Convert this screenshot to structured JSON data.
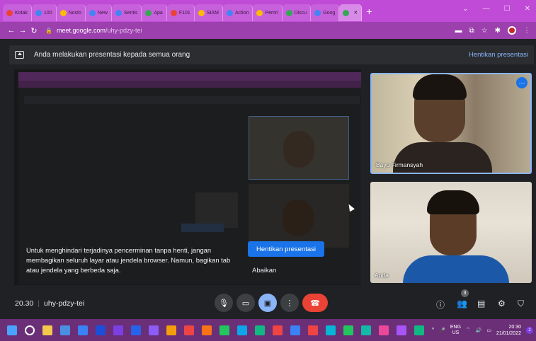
{
  "browser": {
    "tabs": [
      {
        "label": "Kotak",
        "color": "#ea4335"
      },
      {
        "label": "100",
        "color": "#4285f4"
      },
      {
        "label": "Nosto",
        "color": "#fbbc04"
      },
      {
        "label": "New",
        "color": "#4285f4"
      },
      {
        "label": "Sentis",
        "color": "#4285f4"
      },
      {
        "label": "Apa",
        "color": "#34a853"
      },
      {
        "label": "F101",
        "color": "#ea4335"
      },
      {
        "label": "SIAM",
        "color": "#fbbc04"
      },
      {
        "label": "Action",
        "color": "#4285f4"
      },
      {
        "label": "Pemri",
        "color": "#fbbc04"
      },
      {
        "label": "Discu",
        "color": "#34a853"
      },
      {
        "label": "Goog",
        "color": "#4285f4"
      },
      {
        "label": "",
        "color": "#34a853"
      }
    ],
    "url_domain": "meet.google.com",
    "url_path": "/uhy-pdzy-tei"
  },
  "meet": {
    "banner_text": "Anda melakukan presentasi kepada semua orang",
    "banner_stop": "Hentikan presentasi",
    "warning_text": "Untuk menghindari terjadinya pencerminan tanpa henti, jangan membagikan seluruh layar atau jendela browser. Namun, bagikan tab atau jendela yang berbeda saja.",
    "stop_button": "Hentikan presentasi",
    "ignore_button": "Abaikan",
    "participants": [
      {
        "name": "Bayu Firmansyah"
      },
      {
        "name": "Anda"
      }
    ],
    "time": "20.30",
    "meeting_code": "uhy-pdzy-tei",
    "participant_count": "3"
  },
  "taskbar": {
    "language": "ENG",
    "region": "US",
    "time": "20:30",
    "date": "21/01/2022",
    "notifications": "2",
    "app_colors": [
      "#f2c94c",
      "#4a90e2",
      "#3b82f6",
      "#1d4ed8",
      "#7b3fe4",
      "#2563eb",
      "#8b5cf6",
      "#f59e0b",
      "#ef4444",
      "#f97316",
      "#22c55e",
      "#0ea5e9",
      "#10b981",
      "#ef4444",
      "#3b82f6",
      "#ef4444",
      "#06b6d4",
      "#22c55e",
      "#14b8a6",
      "#ec4899",
      "#a855f7",
      "#10b981"
    ]
  }
}
